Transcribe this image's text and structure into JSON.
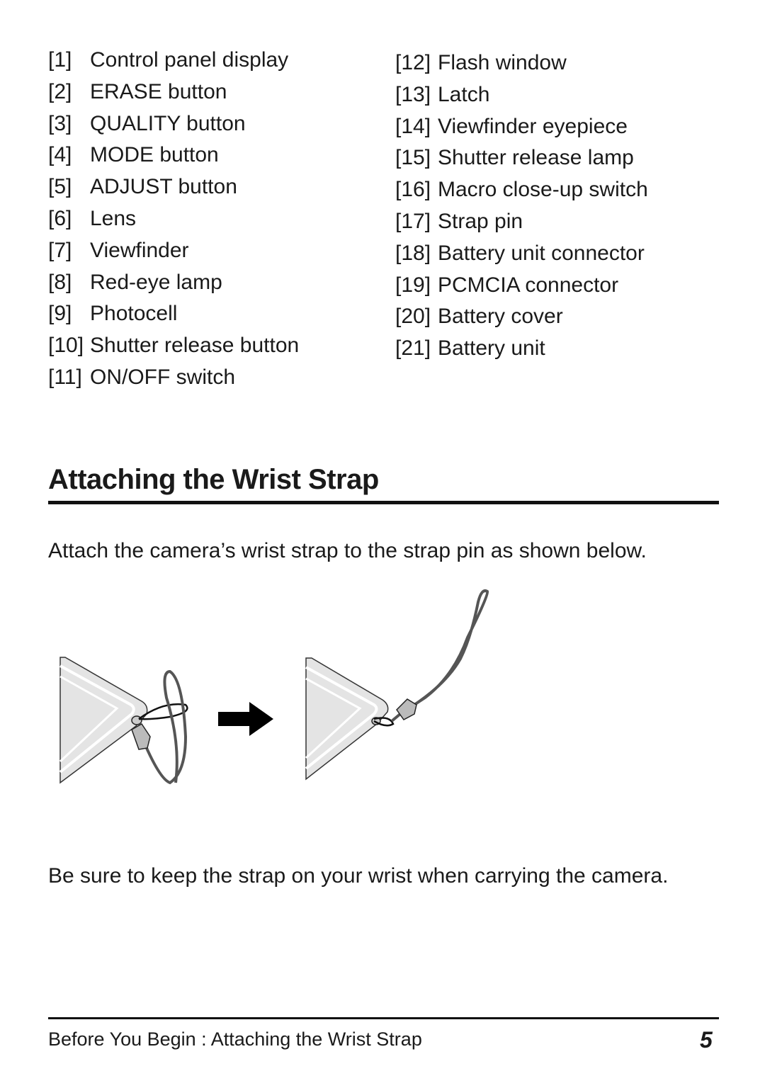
{
  "parts_list": {
    "left": [
      {
        "num": "[1]",
        "label": "Control panel display"
      },
      {
        "num": "[2]",
        "label": "ERASE button"
      },
      {
        "num": "[3]",
        "label": "QUALITY button"
      },
      {
        "num": "[4]",
        "label": "MODE button"
      },
      {
        "num": "[5]",
        "label": "ADJUST button"
      },
      {
        "num": "[6]",
        "label": "Lens"
      },
      {
        "num": "[7]",
        "label": "Viewfinder"
      },
      {
        "num": "[8]",
        "label": "Red-eye lamp"
      },
      {
        "num": "[9]",
        "label": "Photocell"
      },
      {
        "num": "[10]",
        "label": "Shutter release button"
      },
      {
        "num": "[11]",
        "label": "ON/OFF switch"
      }
    ],
    "right": [
      {
        "num": "[12]",
        "label": "Flash window"
      },
      {
        "num": "[13]",
        "label": "Latch"
      },
      {
        "num": "[14]",
        "label": "Viewfinder eyepiece"
      },
      {
        "num": "[15]",
        "label": "Shutter release lamp"
      },
      {
        "num": "[16]",
        "label": "Macro close-up switch"
      },
      {
        "num": "[17]",
        "label": "Strap pin"
      },
      {
        "num": "[18]",
        "label": "Battery unit connector"
      },
      {
        "num": "[19]",
        "label": "PCMCIA connector"
      },
      {
        "num": "[20]",
        "label": "Battery cover"
      },
      {
        "num": "[21]",
        "label": "Battery unit"
      }
    ]
  },
  "section": {
    "title": "Attaching the Wrist Strap",
    "intro": "Attach the camera’s wrist strap to the strap pin as shown below.",
    "note": "Be sure to keep the strap on your wrist when carrying the camera."
  },
  "footer": {
    "breadcrumb": "Before You Begin : Attaching the Wrist Strap",
    "page_number": "5"
  }
}
